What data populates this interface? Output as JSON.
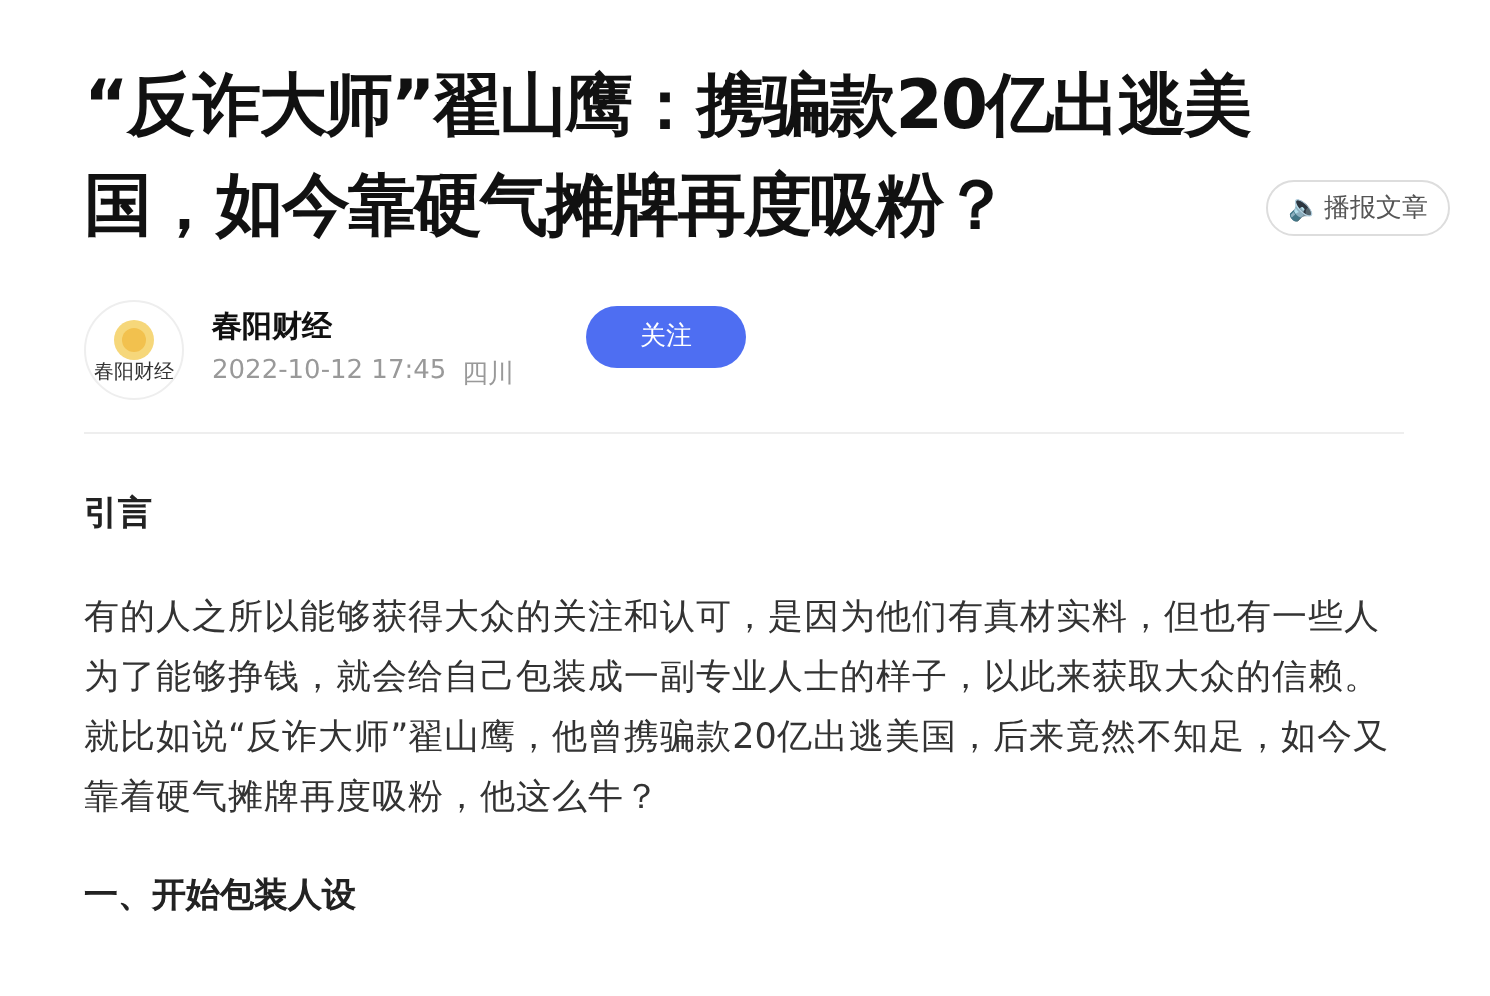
{
  "article": {
    "title": "“反诈大师”翟山鹰：携骗款20亿出逃美国，如今靠硬气摊牌再度吸粉？",
    "listen_button": {
      "icon": "🔈",
      "label": "播报文章"
    }
  },
  "author": {
    "logo_text": "春阳财经",
    "name": "春阳财经",
    "date": "2022-10-12 17:45",
    "location": "四川",
    "follow_button": "关注"
  },
  "body": [
    {
      "kind": "heading",
      "text": "引言"
    },
    {
      "kind": "paragraph",
      "text": "有的人之所以能够获得大众的关注和认可，是因为他们有真材实料，但也有一些人为了能够挣钱，就会给自己包装成一副专业人士的样子，以此来获取大众的信赖。就比如说“反诈大师”翟山鹰，他曾携骗款20亿出逃美国，后来竟然不知足，如今又靠着硬气摊牌再度吸粉，他这么牛？"
    },
    {
      "kind": "heading",
      "text": "一、开始包装人设"
    }
  ]
}
